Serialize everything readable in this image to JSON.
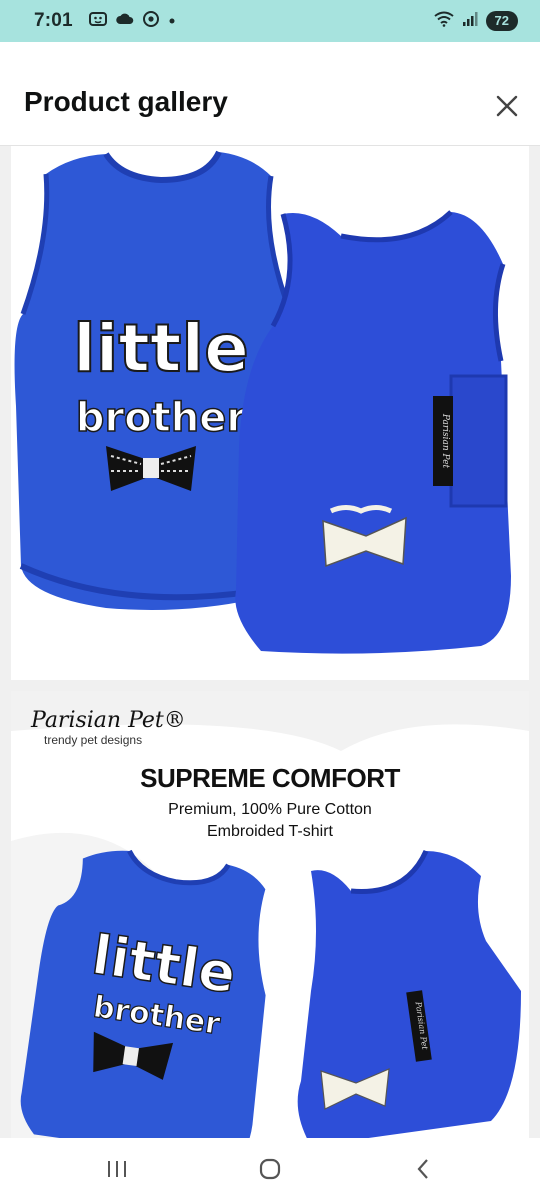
{
  "status_bar": {
    "time": "7:01",
    "battery": "72"
  },
  "sheet": {
    "title": "Product gallery"
  },
  "gallery": {
    "image1": {
      "shirt_text_line1": "little",
      "shirt_text_line2": "brother",
      "label_text": "Parisian Pet"
    },
    "image2": {
      "brand_logo": "Parisian Pet®",
      "brand_tagline": "trendy pet designs",
      "headline": "SUPREME COMFORT",
      "subline1": "Premium, 100% Pure Cotton",
      "subline2": "Embroided T-shirt",
      "shirt_text_line1": "little",
      "shirt_text_line2": "brother",
      "label_text": "Parisian Pet"
    }
  },
  "colors": {
    "status_bar_bg": "#a7e3de",
    "shirt_blue": "#2e58d6",
    "shirt_blue_dark": "#1f3fb3"
  }
}
